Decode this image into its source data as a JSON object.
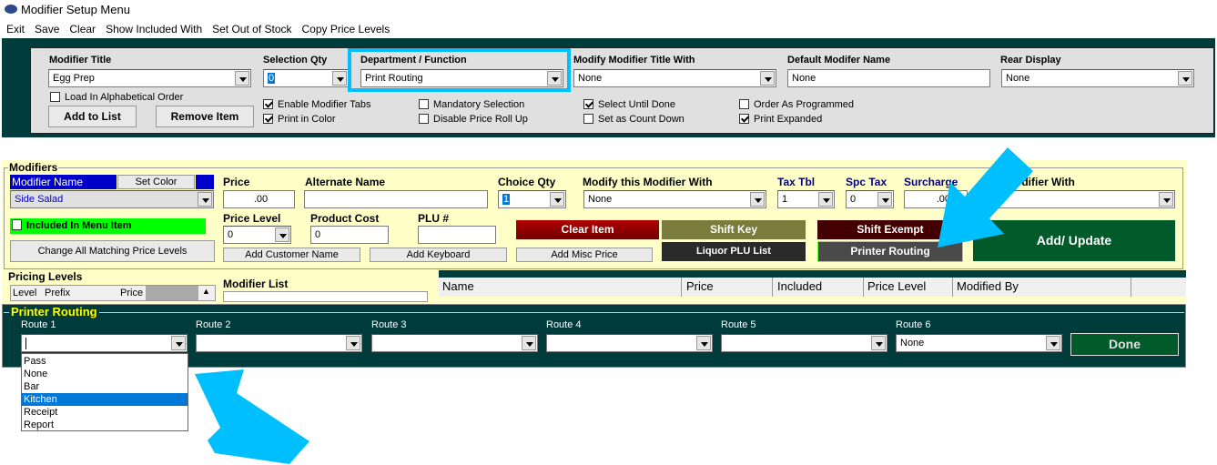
{
  "window": {
    "title": "Modifier Setup Menu",
    "icon": "md-logo-icon"
  },
  "menu": [
    "Exit",
    "Save",
    "Clear",
    "Show Included With",
    "Set Out of Stock",
    "Copy Price Levels"
  ],
  "top": {
    "modifier_title": {
      "label": "Modifier Title",
      "value": "Egg Prep"
    },
    "selection_qty": {
      "label": "Selection Qty",
      "value": "0"
    },
    "department": {
      "label": "Department / Function",
      "value": "Print Routing"
    },
    "modify_title_with": {
      "label": "Modify Modifier Title With",
      "value": "None"
    },
    "default_name": {
      "label": "Default Modifer Name",
      "value": "None"
    },
    "rear_display": {
      "label": "Rear Display",
      "value": "None"
    },
    "load_alpha": {
      "label": "Load In Alphabetical Order",
      "checked": false
    },
    "add_to_list": "Add to List",
    "remove_item": "Remove Item",
    "checks": [
      {
        "label": "Enable Modifier Tabs",
        "checked": true
      },
      {
        "label": "Print in Color",
        "checked": true
      },
      {
        "label": "Mandatory Selection",
        "checked": false
      },
      {
        "label": "Disable Price Roll Up",
        "checked": false
      },
      {
        "label": "Select Until Done",
        "checked": true
      },
      {
        "label": "Set as Count Down",
        "checked": false
      },
      {
        "label": "Order As Programmed",
        "checked": false
      },
      {
        "label": "Print Expanded",
        "checked": true
      }
    ]
  },
  "modifiers": {
    "legend": "Modifiers",
    "name_label": "Modifier Name",
    "set_color": "Set Color",
    "name_value": "Side Salad",
    "included": "Included In Menu Item",
    "change_all": "Change All Matching Price Levels",
    "price": {
      "label": "Price",
      "value": ".00"
    },
    "alt_name": {
      "label": "Alternate Name",
      "value": ""
    },
    "choice_qty": {
      "label": "Choice Qty",
      "value": "1"
    },
    "modify_with": {
      "label": "Modify this Modifier With",
      "value": "None"
    },
    "tax_tbl": {
      "label": "Tax Tbl",
      "value": "1"
    },
    "spc_tax": {
      "label": "Spc Tax",
      "value": "0"
    },
    "surcharge": {
      "label": "Surcharge",
      "value": ".00"
    },
    "modifier_with": {
      "label": "Modifier With",
      "value": ""
    },
    "price_level": {
      "label": "Price Level",
      "value": "0"
    },
    "product_cost": {
      "label": "Product Cost",
      "value": "0"
    },
    "plu": {
      "label": "PLU #",
      "value": ""
    },
    "add_customer_name": "Add Customer Name",
    "add_keyboard": "Add Keyboard",
    "add_misc_price": "Add Misc Price",
    "clear_item": "Clear Item",
    "shift_key": "Shift Key",
    "shift_exempt": "Shift Exempt",
    "liquor_plu": "Liquor PLU List",
    "printer_routing": "Printer Routing",
    "add_update": "Add/ Update"
  },
  "pricing": {
    "legend": "Pricing Levels",
    "columns": [
      "Level",
      "Prefix",
      "Price"
    ]
  },
  "modifier_list": {
    "label": "Modifier List",
    "columns": [
      "Name",
      "Price",
      "Included",
      "Price Level",
      "Modified By"
    ]
  },
  "routing": {
    "legend": "Printer Routing",
    "routes": [
      {
        "label": "Route 1",
        "value": ""
      },
      {
        "label": "Route 2",
        "value": ""
      },
      {
        "label": "Route 3",
        "value": ""
      },
      {
        "label": "Route 4",
        "value": ""
      },
      {
        "label": "Route 5",
        "value": ""
      },
      {
        "label": "Route 6",
        "value": "None"
      }
    ],
    "done": "Done",
    "options": [
      "Pass",
      "None",
      "Bar",
      "Kitchen",
      "Receipt",
      "Report"
    ],
    "selected_option": "Kitchen"
  },
  "colors": {
    "panel": "#003c3c",
    "highlight": "#00bfff",
    "yellow": "#ffffc8",
    "green": "#00ff00",
    "selection": "#0078d7"
  }
}
